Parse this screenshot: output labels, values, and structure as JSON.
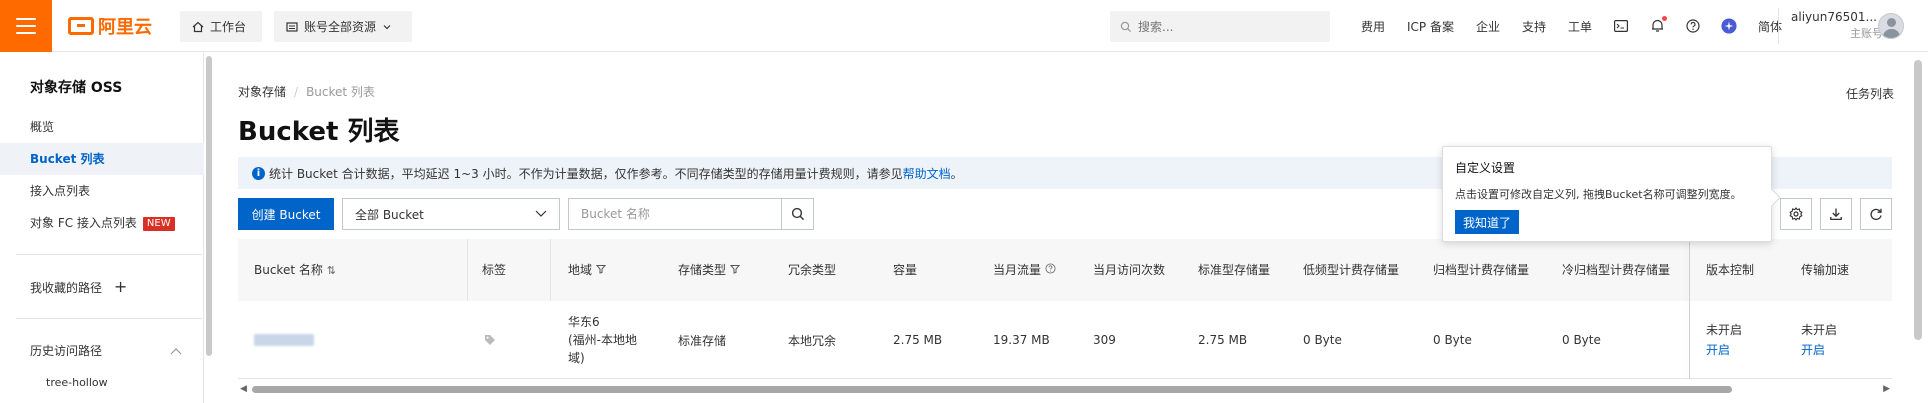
{
  "header": {
    "logo_text": "阿里云",
    "workbench": "工作台",
    "resources": "账号全部资源",
    "search_placeholder": "搜索...",
    "links": [
      "费用",
      "ICP 备案",
      "企业",
      "支持",
      "工单"
    ],
    "language": "简体",
    "user_name": "aliyun76501...",
    "user_role": "主账号"
  },
  "sidebar": {
    "title": "对象存储 OSS",
    "items": [
      "概览",
      "Bucket 列表",
      "接入点列表",
      "对象 FC 接入点列表"
    ],
    "new_badge": "NEW",
    "favorites": "我收藏的路径",
    "history": "历史访问路径",
    "history_items": [
      "tree-hollow"
    ]
  },
  "main": {
    "breadcrumb_root": "对象存储",
    "breadcrumb_current": "Bucket 列表",
    "title": "Bucket 列表",
    "task_list": "任务列表",
    "notice_text": "统计 Bucket 合计数据，平均延迟 1~3 小时。不作为计量数据，仅作参考。不同存储类型的存储用量计费规则，请参见",
    "notice_link": "帮助文档",
    "notice_end": "。",
    "create_button": "创建 Bucket",
    "filter_select": "全部 Bucket",
    "name_placeholder": "Bucket 名称"
  },
  "tooltip": {
    "title": "自定义设置",
    "text": "点击设置可修改自定义列, 拖拽Bucket名称可调整列宽度。",
    "button": "我知道了"
  },
  "table": {
    "headers": [
      "Bucket 名称",
      "标签",
      "地域",
      "存储类型",
      "冗余类型",
      "容量",
      "当月流量",
      "当月访问次数",
      "标准型存储量",
      "低频型计费存储量",
      "归档型计费存储量",
      "冷归档型计费存储量",
      "版本控制",
      "传输加速"
    ],
    "rows": [
      {
        "region": [
          "华东6",
          "(福州-本地地",
          "域)"
        ],
        "storage_type": "标准存储",
        "redundancy": "本地冗余",
        "capacity": "2.75 MB",
        "traffic": "19.37 MB",
        "visits": "309",
        "standard": "2.75 MB",
        "ia": "0 Byte",
        "archive": "0 Byte",
        "cold": "0 Byte",
        "versioning": "未开启",
        "versioning_action": "开启",
        "acceleration": "未开启",
        "acceleration_action": "开启"
      }
    ]
  },
  "colors": {
    "brand": "#ff6a00",
    "primary": "#0064c8",
    "new_badge": "#d93026"
  }
}
